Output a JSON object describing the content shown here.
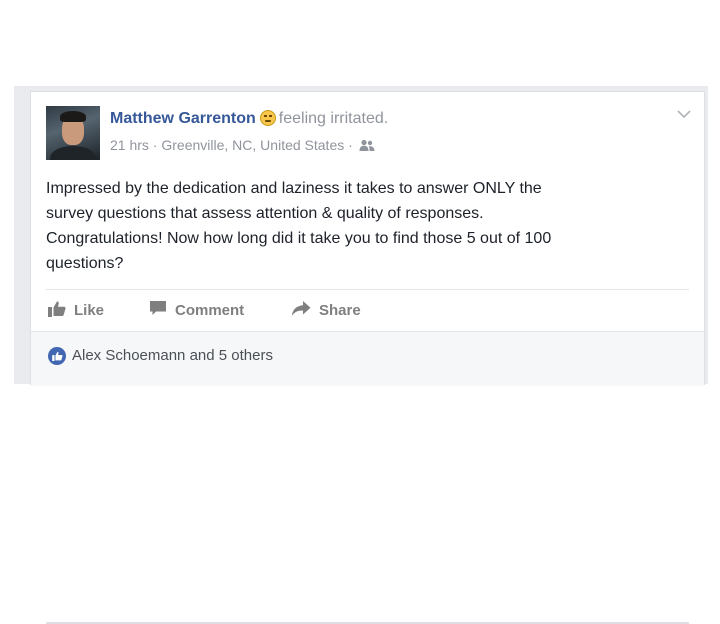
{
  "post": {
    "author": "Matthew Garrenton",
    "feeling": "feeling irritated.",
    "feeling_icon": "irritated-face-icon",
    "time": "21 hrs",
    "separator": " · ",
    "location": "Greenville, NC, United States",
    "audience_separator": " · ",
    "audience_icon": "friends-icon",
    "text": "Impressed by the dedication and laziness it takes to answer ONLY the\nsurvey questions that assess attention & quality of responses.\nCongratulations! Now how long did it take you to find those 5 out of 100\nquestions?"
  },
  "actions": {
    "like_label": "Like",
    "comment_label": "Comment",
    "share_label": "Share"
  },
  "reactions": {
    "summary": "Alex Schoemann and 5 others"
  },
  "colors": {
    "author_link": "#365899",
    "meta_gray": "#90949c",
    "like_blue": "#4267b2",
    "action_gray": "#7f7f7f"
  }
}
